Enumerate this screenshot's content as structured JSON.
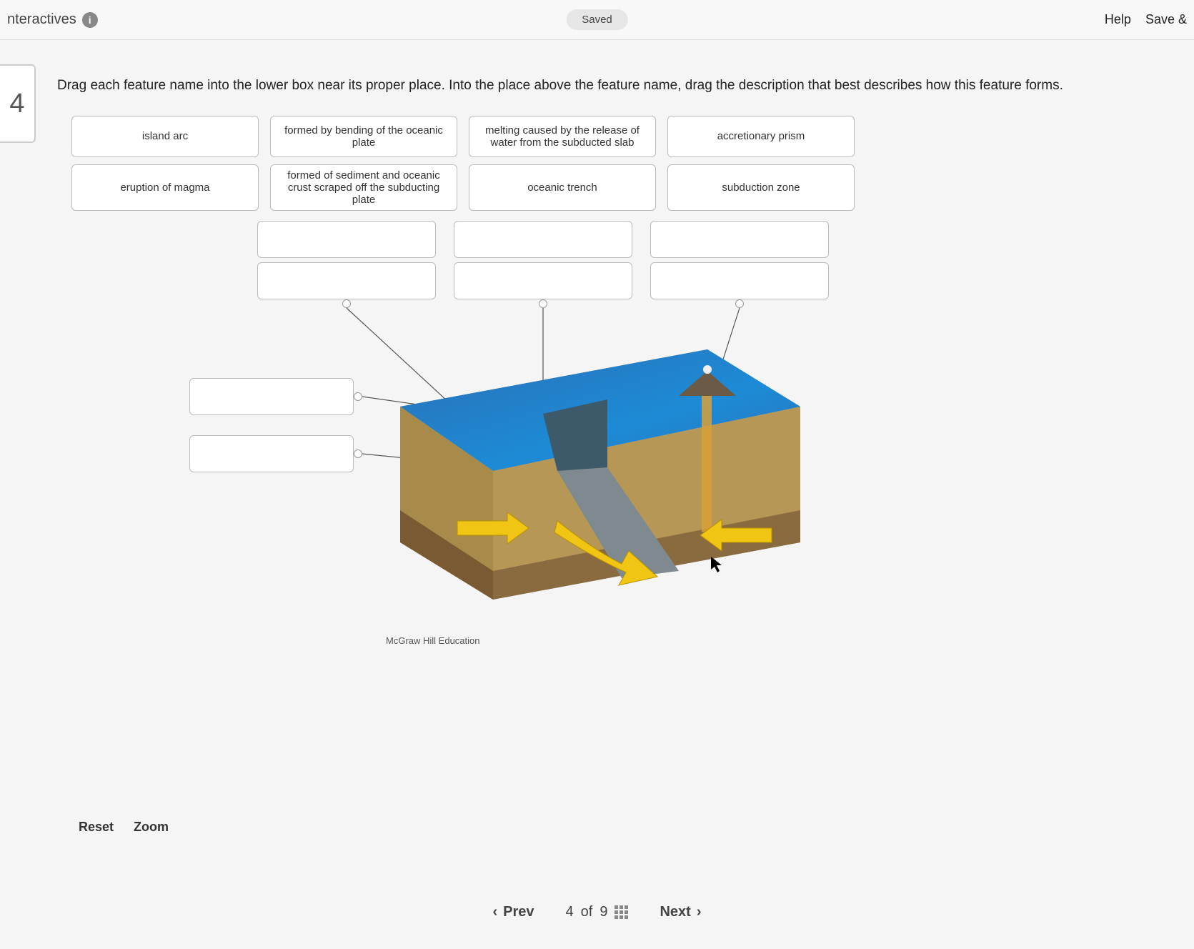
{
  "topbar": {
    "title": "nteractives",
    "saved": "Saved",
    "help": "Help",
    "save_exit": "Save & "
  },
  "qnum": "4",
  "instructions": "Drag each feature name into the lower box near its proper place. Into the place above the feature name, drag the description that best describes how this feature forms.",
  "chips": {
    "row1": [
      "island arc",
      "formed by bending of the oceanic plate",
      "melting caused by the release of water from the subducted slab",
      "accretionary prism"
    ],
    "row2": [
      "eruption of magma",
      "formed of sediment and oceanic crust scraped off the subducting plate",
      "oceanic trench",
      "subduction zone"
    ]
  },
  "credit": "McGraw Hill Education",
  "controls": {
    "reset": "Reset",
    "zoom": "Zoom"
  },
  "pager": {
    "prev": "Prev",
    "pos_current": "4",
    "pos_word": "of",
    "pos_total": "9",
    "next": "Next"
  }
}
